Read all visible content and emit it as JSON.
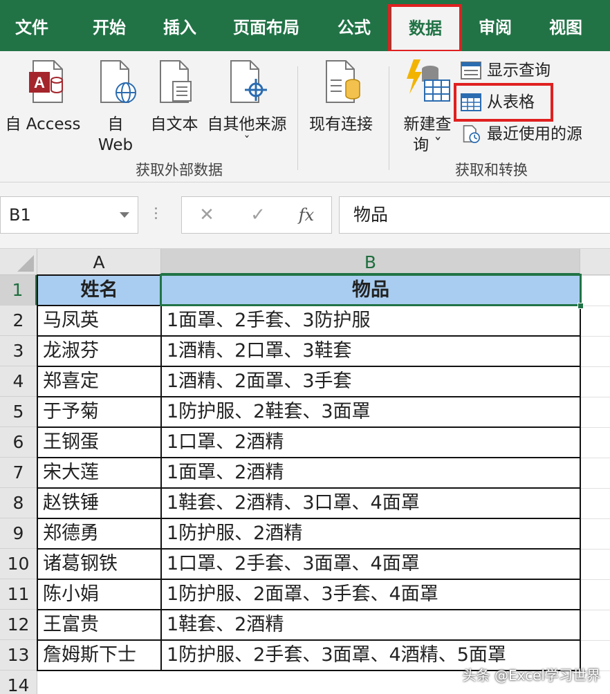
{
  "tabs": [
    {
      "label": "文件"
    },
    {
      "label": "开始"
    },
    {
      "label": "插入"
    },
    {
      "label": "页面布局"
    },
    {
      "label": "公式"
    },
    {
      "label": "数据"
    },
    {
      "label": "审阅"
    },
    {
      "label": "视图"
    }
  ],
  "active_tab": "数据",
  "ribbon": {
    "external": {
      "access": {
        "line1": "自 Access"
      },
      "web": {
        "line1": "自",
        "line2": "Web"
      },
      "text": {
        "line1": "自文本"
      },
      "other": {
        "line1": "自其他来源",
        "line2": "ˇ"
      },
      "group_label": "获取外部数据"
    },
    "existing": {
      "line1": "现有连接"
    },
    "transform": {
      "new_query": {
        "line1": "新建查",
        "line2": "询 ˇ"
      },
      "show_queries": "显示查询",
      "from_table": "从表格",
      "recent_sources": "最近使用的源",
      "group_label": "获取和转换"
    }
  },
  "formula_bar": {
    "name_box": "B1",
    "cancel": "✕",
    "enter": "✓",
    "fx": "fx",
    "content": "物品"
  },
  "sheet": {
    "corner": "",
    "columns": [
      "A",
      "B"
    ],
    "row_numbers": [
      "1",
      "2",
      "3",
      "4",
      "5",
      "6",
      "7",
      "8",
      "9",
      "10",
      "11",
      "12",
      "13",
      "14"
    ],
    "header": {
      "name": "姓名",
      "items": "物品"
    },
    "rows": [
      {
        "name": "马凤英",
        "items": "1面罩、2手套、3防护服"
      },
      {
        "name": "龙淑芬",
        "items": "1酒精、2口罩、3鞋套"
      },
      {
        "name": "郑喜定",
        "items": "1酒精、2面罩、3手套"
      },
      {
        "name": "于予菊",
        "items": "1防护服、2鞋套、3面罩"
      },
      {
        "name": "王钢蛋",
        "items": "1口罩、2酒精"
      },
      {
        "name": "宋大莲",
        "items": "1面罩、2酒精"
      },
      {
        "name": "赵铁锤",
        "items": "1鞋套、2酒精、3口罩、4面罩"
      },
      {
        "name": "郑德勇",
        "items": "1防护服、2酒精"
      },
      {
        "name": "诸葛钢铁",
        "items": "1口罩、2手套、3面罩、4面罩"
      },
      {
        "name": "陈小娟",
        "items": "1防护服、2面罩、3手套、4面罩"
      },
      {
        "name": "王富贵",
        "items": "1鞋套、2酒精"
      },
      {
        "name": "詹姆斯下士",
        "items": "1防护服、2手套、3面罩、4酒精、5面罩"
      }
    ]
  },
  "watermark": "头条 @Excel学习世界",
  "colors": {
    "excel_green": "#217346",
    "header_fill": "#a9cdf0",
    "highlight_red": "#e02020"
  }
}
